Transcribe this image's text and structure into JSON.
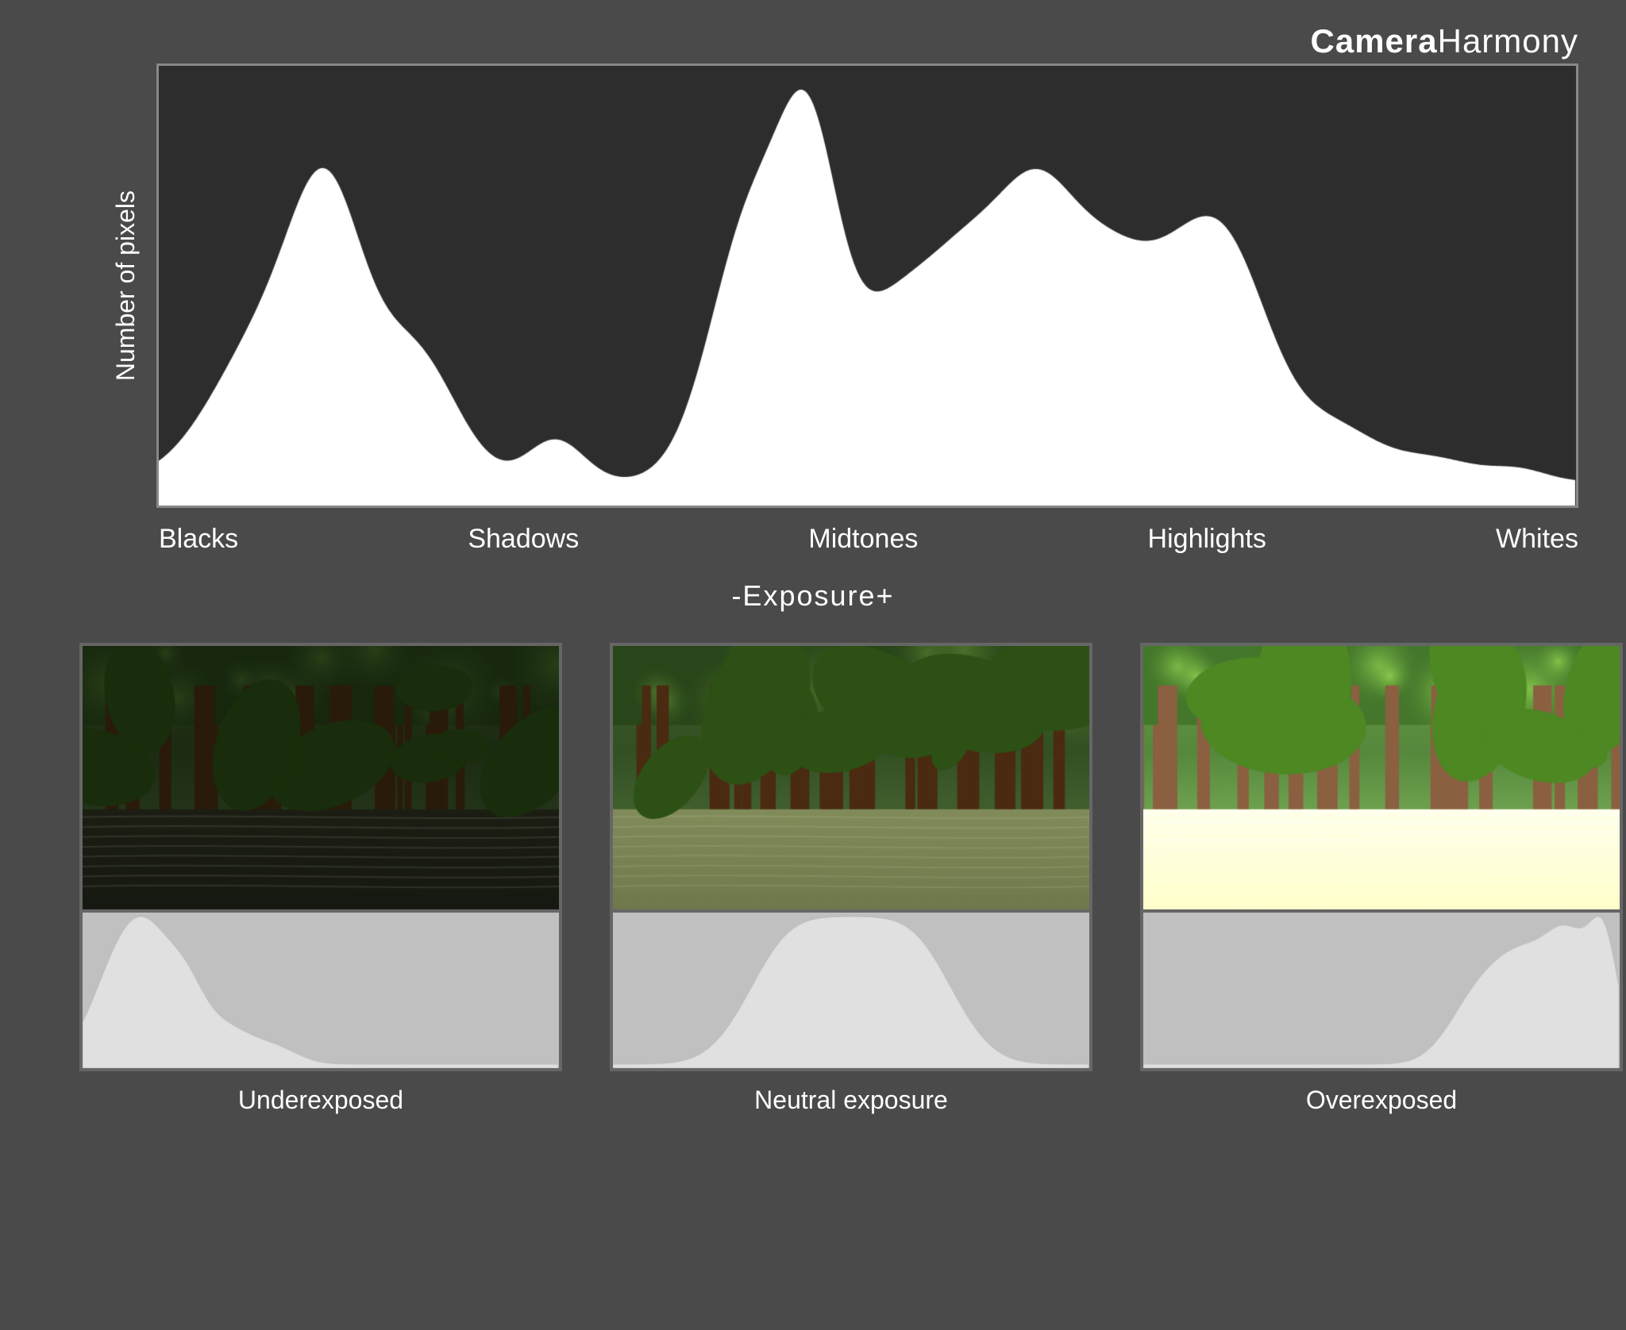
{
  "app": {
    "title_bold": "Camera",
    "title_light": "Harmony"
  },
  "histogram": {
    "y_axis_label": "Number of pixels",
    "x_labels": [
      "Blacks",
      "Shadows",
      "Midtones",
      "Highlights",
      "Whites"
    ]
  },
  "exposure": {
    "label": "-Exposure+"
  },
  "photos": [
    {
      "label": "Underexposed",
      "exposure": "under"
    },
    {
      "label": "Neutral exposure",
      "exposure": "neutral"
    },
    {
      "label": "Overexposed",
      "exposure": "over"
    }
  ]
}
